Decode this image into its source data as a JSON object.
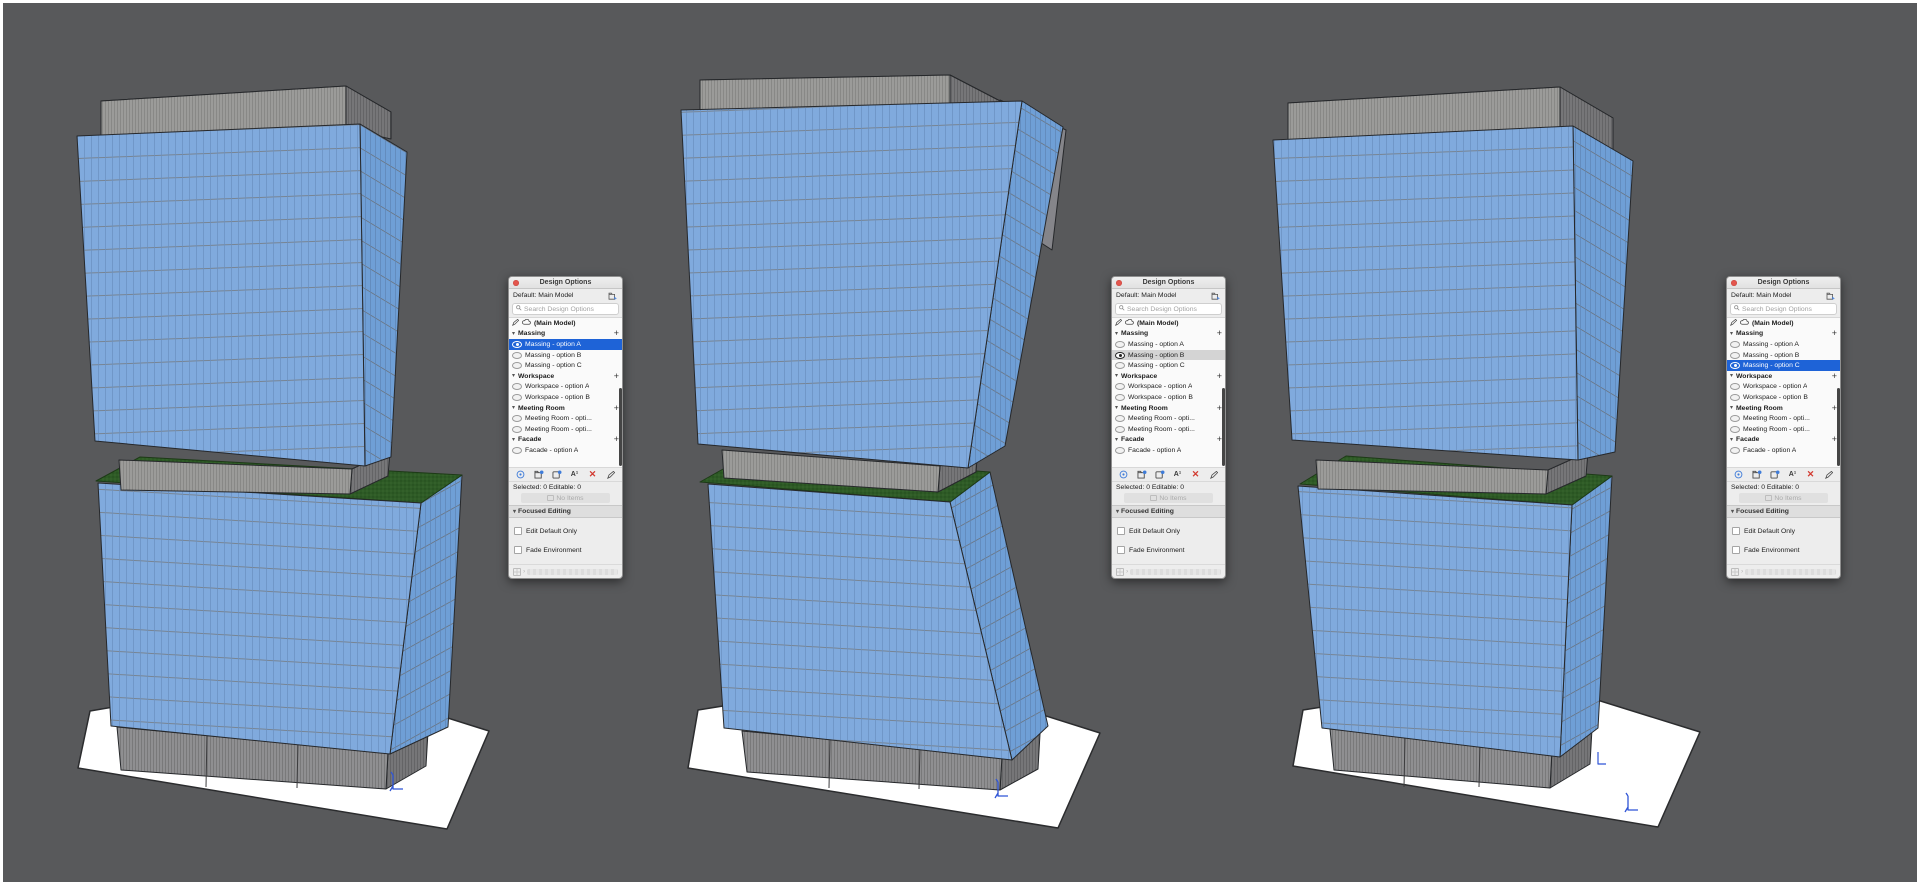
{
  "app": {
    "description": "3D massing study viewports with Design Options palettes",
    "background_color": "#58595b",
    "frame_color": "#ffffff"
  },
  "scene": {
    "colors": {
      "glass_front": "#80aadd",
      "glass_side": "#6f9fd6",
      "concrete_light": "#9b9b99",
      "concrete_mid": "#8f8f91",
      "concrete_dark": "#767678",
      "roof_green": "#2e5b26",
      "ground_plane": "#ffffff",
      "edge_line": "#26282b",
      "axis_marker": "#2f55d6"
    },
    "views": [
      {
        "name": "massing-option-a",
        "active_option": "Massing - option A"
      },
      {
        "name": "massing-option-b",
        "active_option": "Massing - option B"
      },
      {
        "name": "massing-option-c",
        "active_option": "Massing - option C"
      }
    ]
  },
  "panel_common": {
    "title": "Design Options",
    "default_label": "Default: Main Model",
    "search_placeholder": "Search Design Options",
    "rows": [
      {
        "type": "model",
        "label": "(Main Model)"
      },
      {
        "type": "group",
        "label": "Massing"
      },
      {
        "type": "option",
        "label": "Massing - option A"
      },
      {
        "type": "option",
        "label": "Massing - option B"
      },
      {
        "type": "option",
        "label": "Massing - option C"
      },
      {
        "type": "group",
        "label": "Workspace"
      },
      {
        "type": "option",
        "label": "Workspace - option A"
      },
      {
        "type": "option",
        "label": "Workspace - option B"
      },
      {
        "type": "group",
        "label": "Meeting Room"
      },
      {
        "type": "option",
        "label": "Meeting Room - opti..."
      },
      {
        "type": "option",
        "label": "Meeting Room - opti..."
      },
      {
        "type": "group",
        "label": "Facade"
      },
      {
        "type": "option",
        "label": "Facade - option A"
      }
    ],
    "icons": {
      "disclosure": "▾",
      "add": "+",
      "rename": "A¹",
      "delete": "✕",
      "chevron": "›"
    },
    "toolbar_icon_names": [
      "visibility-icon",
      "new-option-set-icon",
      "new-option-icon",
      "rename-icon",
      "delete-icon",
      "edit-icon"
    ],
    "status": "Selected: 0 Editable: 0",
    "items_button": "No Items",
    "focused_editing": "Focused Editing",
    "checkboxes": [
      "Edit Default Only",
      "Fade Environment"
    ],
    "selection_color": "#1e63d7"
  },
  "panels": [
    {
      "active_option": "Massing - option A",
      "highlight": "blue"
    },
    {
      "active_option": "Massing - option B",
      "highlight": "gray"
    },
    {
      "active_option": "Massing - option C",
      "highlight": "blue"
    }
  ]
}
